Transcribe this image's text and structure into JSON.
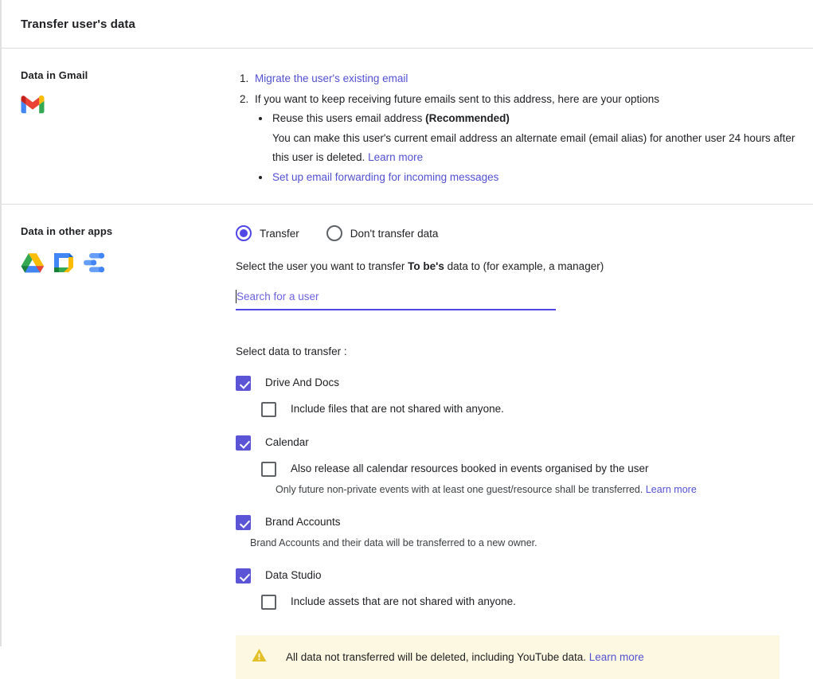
{
  "header": {
    "title": "Transfer user's data"
  },
  "gmail_section": {
    "label": "Data in Gmail",
    "app_icon": "gmail-icon",
    "item1_link": "Migrate the user's existing email",
    "item2_text": "If you want to keep receiving future emails sent to this address, here are your options",
    "bullet1_text": "Reuse this users email address ",
    "bullet1_bold": "(Recommended)",
    "bullet1_desc": "You can make this user's current email address an alternate email (email alias) for another user 24 hours after this user is deleted. ",
    "bullet1_link": "Learn more",
    "bullet2_link": "Set up email forwarding for incoming messages"
  },
  "other_apps_section": {
    "label": "Data in other apps",
    "app_icons": [
      "google-drive-icon",
      "google-calendar-icon",
      "data-studio-icon"
    ],
    "radio_options": [
      {
        "label": "Transfer",
        "selected": true
      },
      {
        "label": "Don't transfer data",
        "selected": false
      }
    ],
    "select_user_text_before": "Select the user you want to transfer ",
    "select_user_bold": "To be's",
    "select_user_text_after": " data to (for example, a manager)",
    "search": {
      "value": "",
      "placeholder": "Search for a user"
    },
    "select_data_label": "Select data to transfer :",
    "checkbox_groups": [
      {
        "label": "Drive And Docs",
        "checked": true,
        "sub_label": "Include files that are not shared with anyone.",
        "sub_checked": false
      },
      {
        "label": "Calendar",
        "checked": true,
        "sub_label": "Also release all calendar resources booked in events organised by the user",
        "sub_checked": false,
        "note": "Only future non-private events with at least one guest/resource shall be transferred. ",
        "note_link": "Learn more"
      },
      {
        "label": "Brand Accounts",
        "checked": true,
        "note": "Brand Accounts and their data will be transferred to a new owner."
      },
      {
        "label": "Data Studio",
        "checked": true,
        "sub_label": "Include assets that are not shared with anyone.",
        "sub_checked": false
      }
    ],
    "warning": {
      "icon": "warning-triangle-icon",
      "text": "All data not transferred will be deleted, including YouTube data. ",
      "link": "Learn more"
    }
  },
  "colors": {
    "accent": "#4f46e5",
    "checkbox": "#5b54d6",
    "link": "#5151d3",
    "warning_bg": "#fdf8e1",
    "warning_icon": "#e3c02a",
    "divider": "#dadce0"
  }
}
